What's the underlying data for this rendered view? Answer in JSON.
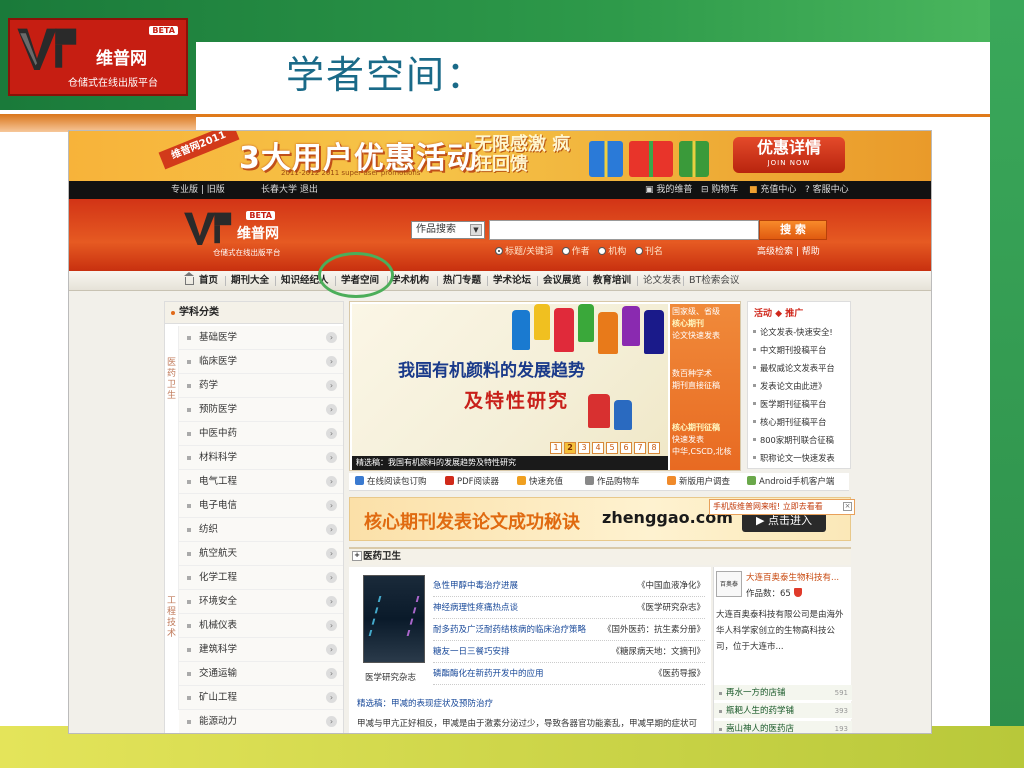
{
  "slide": {
    "title": "学者空间：",
    "logo": {
      "beta": "BETA",
      "name": "维普网",
      "tagline": "仓储式在线出版平台"
    }
  },
  "site": {
    "promo": {
      "ribbon": "维普网2011",
      "headline": "3大用户优惠活动",
      "side_text": "无限感激 疯狂回馈",
      "subline": "2011-2012 2011 super user promotions",
      "button_label": "优惠详情",
      "button_sub": "JOIN NOW"
    },
    "topbar": {
      "left_links": "专业版 | 旧版",
      "user": "长春大学 退出",
      "my_vip": "我的维普",
      "cart": "购物车",
      "recharge": "充值中心",
      "service": "客服中心"
    },
    "header": {
      "logo": {
        "beta": "BETA",
        "name": "维普网",
        "tagline": "仓储式在线出版平台"
      },
      "search_type": "作品搜索",
      "search_placeholder": "",
      "search_button": "搜 索",
      "options": [
        "标题/关键词",
        "作者",
        "机构",
        "刊名"
      ],
      "adv_links": "高级检索 | 帮助"
    },
    "nav": [
      "首页",
      "期刊大全",
      "知识经纪人",
      "学者空间",
      "学术机构",
      "热门专题",
      "学术论坛",
      "会议展览",
      "教育培训",
      "论文发表",
      "BT检索会议"
    ],
    "sidebar": {
      "heading": "学科分类",
      "group_medical": "医药卫生",
      "group_engineering": "工程技术",
      "items": [
        "基础医学",
        "临床医学",
        "药学",
        "预防医学",
        "中医中药",
        "材料科学",
        "电气工程",
        "电子电信",
        "纺织",
        "航空航天",
        "化学工程",
        "环境安全",
        "机械仪表",
        "建筑科学",
        "交通运输",
        "矿山工程",
        "能源动力"
      ]
    },
    "feature": {
      "title": "我国有机颜料的发展趋势",
      "subtitle": "及特性研究",
      "pages": [
        "1",
        "2",
        "3",
        "4",
        "5",
        "6",
        "7",
        "8"
      ],
      "caption": "精选稿：我国有机颜料的发展趋势及特性研究",
      "side": {
        "b1": "国家级、省级",
        "b2": "核心期刊",
        "b3": "论文快速发表",
        "b4": "数百种学术",
        "b5": "期刊直接征稿",
        "b6": "核心期刊征稿",
        "b7": "快速发表",
        "b8": "中华,CSCD,北核"
      }
    },
    "ads": {
      "heading": "活动 ◆ 推广",
      "items": [
        "论文发表-快速安全!",
        "中文期刊投稿平台",
        "最权威论文发表平台",
        "发表论文由此进》",
        "医学期刊征稿平台",
        "核心期刊征稿平台",
        "800家期刊联合征稿",
        "职称论文一快速发表"
      ]
    },
    "toolbar": {
      "reader_cart": "在线阅读包订购",
      "pdf": "PDF阅读器",
      "recharge": "快速充值",
      "cart": "作品购物车",
      "survey": "新版用户调查",
      "android": "Android手机客户端"
    },
    "core_banner": {
      "title": "核心期刊发表论文成功秘诀",
      "domain": "zhenggao.com",
      "button": "点击进入"
    },
    "mobile_tip": "手机版维普网来啦! 立即去看看",
    "section": {
      "title": "医药卫生",
      "journal_label": "医学研究杂志",
      "articles": [
        {
          "title": "急性甲醇中毒治疗进展",
          "source": "《中国血液净化》"
        },
        {
          "title": "神经病理性疼痛热点谈",
          "source": "《医学研究杂志》"
        },
        {
          "title": "耐多药及广泛耐药结核病的临床治疗策略",
          "source": "《国外医药：抗生素分册》"
        },
        {
          "title": "糖友一日三餐巧安排",
          "source": "《糖尿病天地：文摘刊》"
        },
        {
          "title": "磷酯酶化在新药开发中的应用",
          "source": "《医药导报》"
        }
      ],
      "featured_link": "精选稿：甲减的表现症状及预防治疗",
      "featured_text": "甲减与甲亢正好相反，甲减是由于激素分泌过少，导致各器官功能紊乱，甲减早期的症状可"
    },
    "company": {
      "logo_text": "百奥泰",
      "name": "大连百奥泰生物科技有...",
      "count_label": "作品数：65",
      "desc": "大连百奥泰科技有限公司是由海外华人科学家创立的生物高科技公司，位于大连市...",
      "rows": [
        {
          "name": "再水一方的店铺",
          "count": "591"
        },
        {
          "name": "瓶耙人生的药学铺",
          "count": "393"
        },
        {
          "name": "嵩山神人的医药店",
          "count": "193"
        }
      ]
    }
  }
}
